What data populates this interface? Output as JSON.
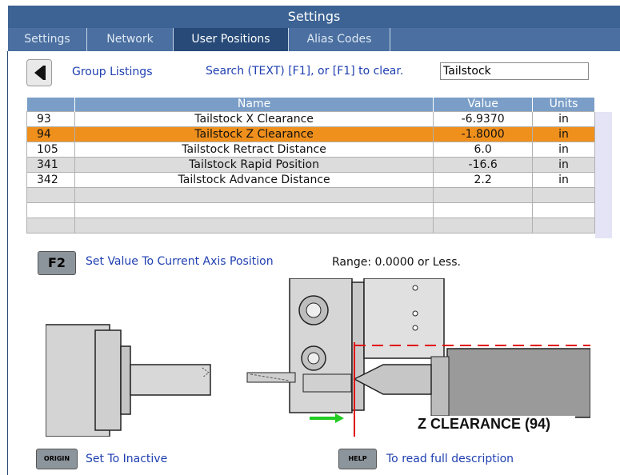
{
  "window": {
    "title": "Settings"
  },
  "tabs": [
    {
      "label": "Settings"
    },
    {
      "label": "Network"
    },
    {
      "label": "User Positions"
    },
    {
      "label": "Alias Codes"
    }
  ],
  "nav": {
    "group_listings": "Group Listings"
  },
  "search": {
    "hint": "Search (TEXT) [F1], or [F1] to clear.",
    "value": "Tailstock"
  },
  "table": {
    "headers": [
      "",
      "Name",
      "Value",
      "Units"
    ],
    "rows": [
      {
        "num": "93",
        "name": "Tailstock X Clearance",
        "value": "-6.9370",
        "units": "in"
      },
      {
        "num": "94",
        "name": "Tailstock Z Clearance",
        "value": "-1.8000",
        "units": "in"
      },
      {
        "num": "105",
        "name": "Tailstock Retract Distance",
        "value": "6.0",
        "units": "in"
      },
      {
        "num": "341",
        "name": "Tailstock Rapid Position",
        "value": "-16.6",
        "units": "in"
      },
      {
        "num": "342",
        "name": "Tailstock Advance Distance",
        "value": "2.2",
        "units": "in"
      }
    ],
    "selected_row": "94"
  },
  "f2": {
    "key": "F2",
    "label": "Set Value To Current Axis Position",
    "range": "Range: 0.0000 or Less."
  },
  "diagram": {
    "caption": "Z CLEARANCE (94)"
  },
  "footer": {
    "origin_key": "ORIGIN",
    "origin_label": "Set To Inactive",
    "help_key": "HELP",
    "help_label": "To read full description"
  },
  "colors": {
    "title_bar": "#3c6394",
    "tab_active": "#274a78",
    "header": "#7a9ec7",
    "selected_row": "#f0901c",
    "link": "#1f3fb0"
  }
}
